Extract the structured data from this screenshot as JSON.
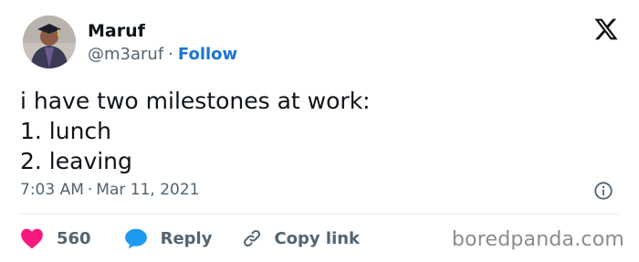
{
  "author": {
    "name": "Maruf",
    "handle": "@m3aruf",
    "separator": "·",
    "follow_label": "Follow"
  },
  "tweet": {
    "lines": [
      "i have two milestones at work:",
      "1. lunch",
      "2. leaving"
    ],
    "time": "7:03 AM",
    "date": "Mar 11, 2021",
    "separator": "·"
  },
  "actions": {
    "like_count": "560",
    "reply_label": "Reply",
    "copy_link_label": "Copy link"
  },
  "watermark": "boredpanda.com",
  "icons": {
    "platform": "x-logo-icon",
    "info": "info-icon",
    "like": "heart-icon",
    "reply": "speech-bubble-icon",
    "copy": "link-icon"
  },
  "colors": {
    "like": "#f91880",
    "reply": "#1d9bf0",
    "follow": "#1d75d1",
    "secondary_text": "#536471"
  }
}
